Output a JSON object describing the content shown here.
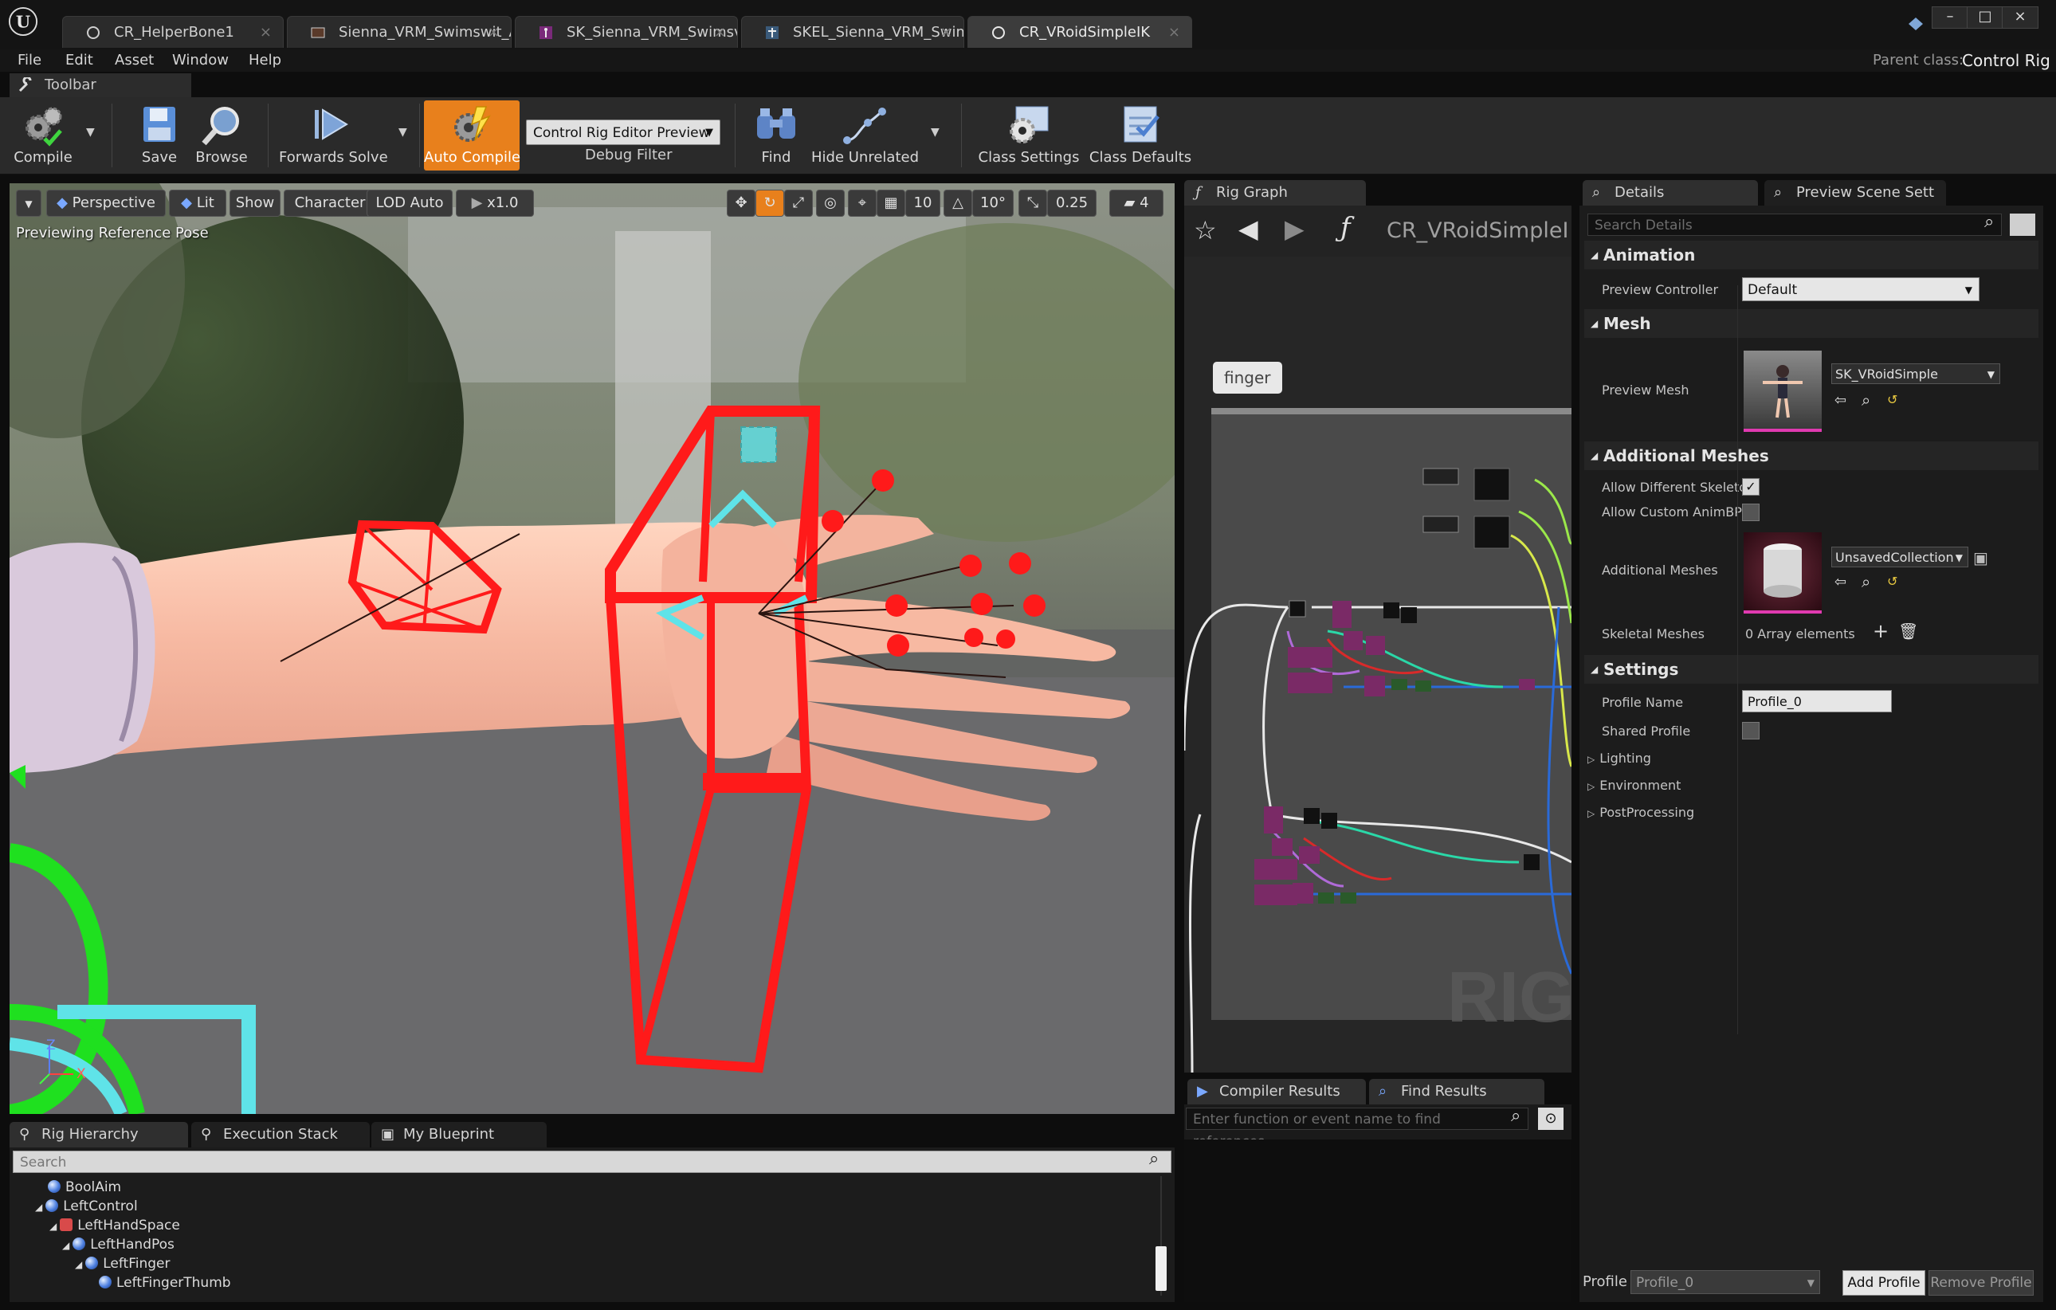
{
  "doc_tabs": [
    {
      "label": "CR_HelperBone1",
      "active": false
    },
    {
      "label": "Sienna_VRM_Swimswit_A",
      "active": false
    },
    {
      "label": "SK_Sienna_VRM_Swimsv",
      "active": false
    },
    {
      "label": "SKEL_Sienna_VRM_Swim",
      "active": false
    },
    {
      "label": "CR_VRoidSimpleIK",
      "active": true
    }
  ],
  "menu": [
    "File",
    "Edit",
    "Asset",
    "Window",
    "Help"
  ],
  "parent_class": {
    "label": "Parent class:",
    "value": "Control Rig"
  },
  "toolbar": {
    "tab_label": "Toolbar",
    "compile": "Compile",
    "save": "Save",
    "browse": "Browse",
    "forwards_solve": "Forwards Solve",
    "auto_compile": "Auto Compile",
    "debug_dropdown": "Control Rig Editor Preview",
    "debug_filter": "Debug Filter",
    "find": "Find",
    "hide_unrelated": "Hide Unrelated",
    "class_settings": "Class Settings",
    "class_defaults": "Class Defaults"
  },
  "viewport": {
    "perspective": "Perspective",
    "lit": "Lit",
    "show": "Show",
    "character": "Character",
    "lod": "LOD Auto",
    "speed": "x1.0",
    "grid_snap": "10",
    "rot_snap": "10°",
    "scale_snap": "0.25",
    "camera_speed": "4",
    "status": "Previewing Reference Pose",
    "axis_z": "Z",
    "axis_x": "X"
  },
  "rig_graph": {
    "tab": "Rig Graph",
    "title": "CR_VRoidSimpleI",
    "comment": "finger",
    "watermark": "RIG"
  },
  "bottom_tabs": [
    "Rig Hierarchy",
    "Execution Stack",
    "My Blueprint"
  ],
  "hierarchy": {
    "search_placeholder": "Search",
    "items": [
      {
        "label": "BoolAim",
        "indent": 0
      },
      {
        "label": "LeftControl",
        "indent": 0
      },
      {
        "label": "LeftHandSpace",
        "indent": 1
      },
      {
        "label": "LeftHandPos",
        "indent": 2
      },
      {
        "label": "LeftFinger",
        "indent": 3
      },
      {
        "label": "LeftFingerThumb",
        "indent": 4
      }
    ]
  },
  "compiler": {
    "tab1": "Compiler Results",
    "tab2": "Find Results",
    "find_placeholder": "Enter function or event name to find references..."
  },
  "details": {
    "tab1": "Details",
    "tab2": "Preview Scene Sett",
    "search_placeholder": "Search Details",
    "animation": {
      "header": "Animation",
      "preview_controller_label": "Preview Controller",
      "preview_controller_value": "Default"
    },
    "mesh": {
      "header": "Mesh",
      "preview_mesh_label": "Preview Mesh",
      "preview_mesh_value": "SK_VRoidSimple"
    },
    "additional": {
      "header": "Additional Meshes",
      "allow_diff_skel": "Allow Different Skeletor",
      "allow_custom_animbp": "Allow Custom AnimBP (",
      "additional_meshes_label": "Additional Meshes",
      "additional_meshes_value": "UnsavedCollection",
      "skeletal_meshes_label": "Skeletal Meshes",
      "skeletal_meshes_value": "0 Array elements"
    },
    "settings": {
      "header": "Settings",
      "profile_name_label": "Profile Name",
      "profile_name_value": "Profile_0",
      "shared_profile_label": "Shared Profile",
      "lighting": "Lighting",
      "environment": "Environment",
      "postprocessing": "PostProcessing"
    },
    "footer": {
      "profile_label": "Profile",
      "profile_value": "Profile_0",
      "add_profile": "Add Profile",
      "remove_profile": "Remove Profile"
    }
  },
  "colors": {
    "accent_orange": "#e8801c",
    "rig_red": "#ff1a1a",
    "rig_cyan": "#5fe3e8",
    "rig_green": "#1fe01f",
    "node_purple": "#7a2a66"
  }
}
